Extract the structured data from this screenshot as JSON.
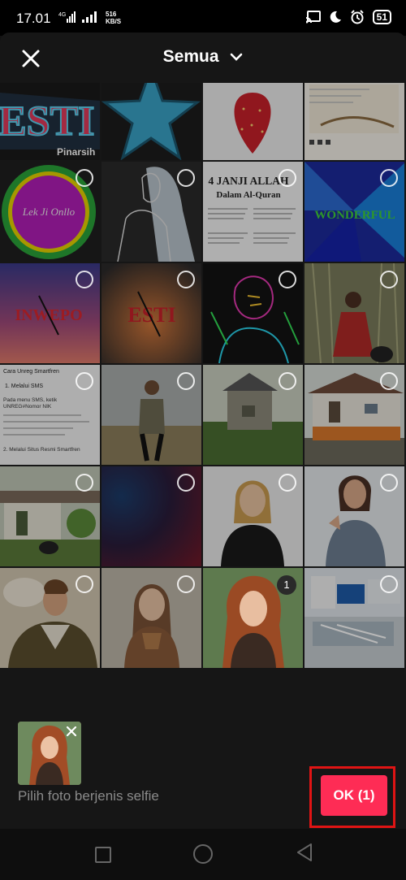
{
  "status_bar": {
    "time": "17.01",
    "network": "4G",
    "speed_value": "516",
    "speed_unit": "KB/S",
    "battery": "51"
  },
  "header": {
    "title": "Semua",
    "close_icon": "close-icon",
    "dropdown_icon": "chevron-down-icon"
  },
  "grid": {
    "images_text": {
      "esti_banner": "ESTI",
      "esti_banner_sub": "Pinarsih",
      "janji_title": "4 JANJI ALLAH",
      "janji_sub": "Dalam Al-Quran",
      "wonderful": "WONDERFUL",
      "inwepo": "INWEPO",
      "esti_dark": "ESTI",
      "badge_text": "Lek Ji Onllo",
      "doc_title": "Cara Unreg Smartfren",
      "doc_line1": "1. Melalui SMS",
      "doc_line2": "Pada menu SMS, ketik",
      "doc_line3": "UNREG#Nomor NIK",
      "doc_line4": "2. Melalui Situs Resmi Smartfren"
    },
    "selected_number": "1"
  },
  "selection": {
    "remove_icon": "close-icon"
  },
  "footer": {
    "hint": "Pilih foto berjenis selfie",
    "ok_label": "OK (1)",
    "ok_color": "#fe2c55"
  },
  "nav": {
    "recent_icon": "square-icon",
    "home_icon": "circle-icon",
    "back_icon": "triangle-back-icon"
  }
}
